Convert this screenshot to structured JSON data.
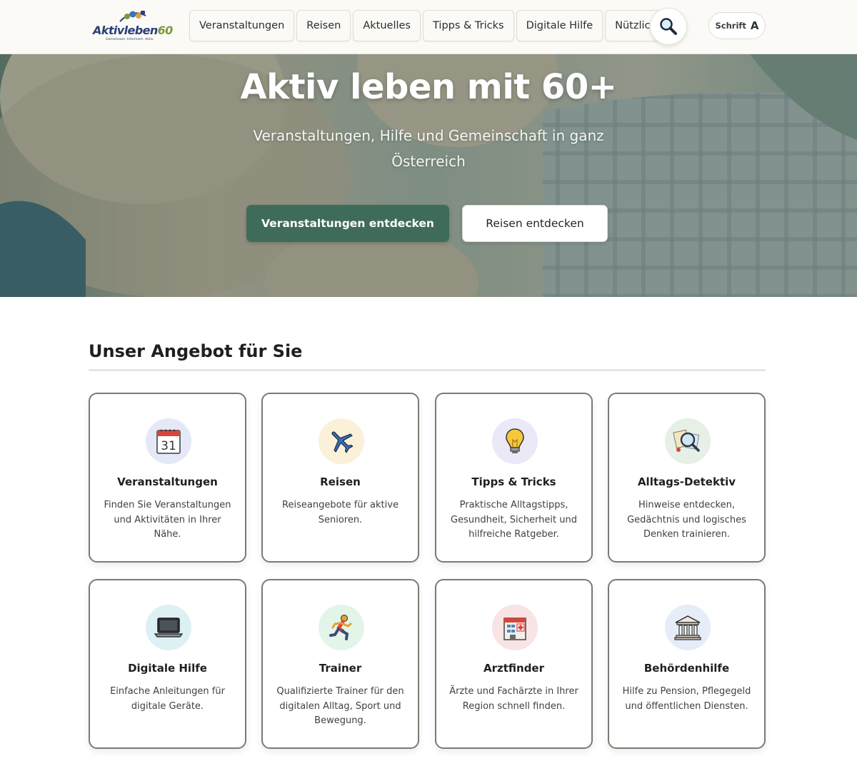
{
  "logo": {
    "name_main": "Aktivleben",
    "name_num": "60",
    "tagline": "Gemeinsam. Informiert. Aktiv."
  },
  "nav": {
    "items": [
      "Veranstaltungen",
      "Reisen",
      "Aktuelles",
      "Tipps & Tricks",
      "Digitale Hilfe",
      "Nützliches"
    ]
  },
  "header": {
    "search_icon": "search-icon",
    "font_label": "Schrift",
    "font_glyph": "A"
  },
  "hero": {
    "title": "Aktiv leben mit 60+",
    "subtitle": "Veranstaltungen, Hilfe und Gemeinschaft in ganz Österreich",
    "primary_button": "Veranstaltungen entdecken",
    "secondary_button": "Reisen entdecken"
  },
  "offers": {
    "title": "Unser Angebot für Sie",
    "cards": [
      {
        "title": "Veranstaltungen",
        "desc": "Finden Sie Veranstaltungen und Aktivitäten in Ihrer Nähe.",
        "icon": "calendar-icon",
        "icon_text": "31",
        "bg": "#e4e9f8"
      },
      {
        "title": "Reisen",
        "desc": "Reiseangebote für aktive Senioren.",
        "icon": "airplane-icon",
        "bg": "#fbf1d8"
      },
      {
        "title": "Tipps & Tricks",
        "desc": "Praktische Alltagstipps, Gesundheit, Sicherheit und hilfreiche Ratgeber.",
        "icon": "lightbulb-icon",
        "bg": "#ebe8f8"
      },
      {
        "title": "Alltags-Detektiv",
        "desc": "Hinweise entdecken, Gedächtnis und logisches Denken trainieren.",
        "icon": "magnifier-clues-icon",
        "bg": "#e6f0e6"
      },
      {
        "title": "Digitale Hilfe",
        "desc": "Einfache Anleitungen für digitale Geräte.",
        "icon": "laptop-icon",
        "bg": "#ddf0f3"
      },
      {
        "title": "Trainer",
        "desc": "Qualifizierte Trainer für den digitalen Alltag, Sport und Bewegung.",
        "icon": "runner-icon",
        "bg": "#e3f5e9"
      },
      {
        "title": "Arztfinder",
        "desc": "Ärzte und Fachärzte in Ihrer Region schnell finden.",
        "icon": "hospital-icon",
        "bg": "#f8e3e5"
      },
      {
        "title": "Behördenhilfe",
        "desc": "Hilfe zu Pension, Pflegegeld und öffentlichen Diensten.",
        "icon": "government-building-icon",
        "bg": "#e6ecf8"
      }
    ]
  }
}
